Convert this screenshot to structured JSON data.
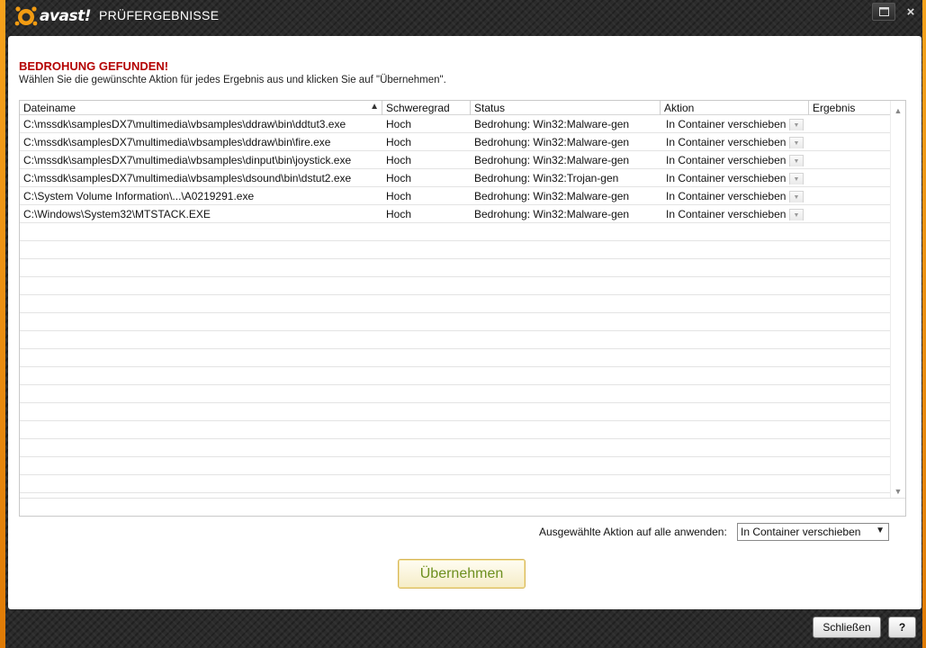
{
  "window": {
    "brand": "avast!",
    "title": "PRÜFERGEBNISSE",
    "close_glyph": "×"
  },
  "message": {
    "heading": "BEDROHUNG GEFUNDEN!",
    "instruction": "Wählen Sie die gewünschte Aktion für jedes Ergebnis aus und klicken Sie auf \"Übernehmen\"."
  },
  "grid": {
    "columns": [
      "Dateiname",
      "Schweregrad",
      "Status",
      "Aktion",
      "Ergebnis"
    ],
    "sort_column": "Dateiname",
    "sort_direction": "ascending",
    "rows": [
      {
        "file": "C:\\mssdk\\samplesDX7\\multimedia\\vbsamples\\ddraw\\bin\\ddtut3.exe",
        "severity": "Hoch",
        "status": "Bedrohung: Win32:Malware-gen",
        "action": "In Container verschieben",
        "result": ""
      },
      {
        "file": "C:\\mssdk\\samplesDX7\\multimedia\\vbsamples\\ddraw\\bin\\fire.exe",
        "severity": "Hoch",
        "status": "Bedrohung: Win32:Malware-gen",
        "action": "In Container verschieben",
        "result": ""
      },
      {
        "file": "C:\\mssdk\\samplesDX7\\multimedia\\vbsamples\\dinput\\bin\\joystick.exe",
        "severity": "Hoch",
        "status": "Bedrohung: Win32:Malware-gen",
        "action": "In Container verschieben",
        "result": ""
      },
      {
        "file": "C:\\mssdk\\samplesDX7\\multimedia\\vbsamples\\dsound\\bin\\dstut2.exe",
        "severity": "Hoch",
        "status": "Bedrohung: Win32:Trojan-gen",
        "action": "In Container verschieben",
        "result": ""
      },
      {
        "file": "C:\\System Volume Information\\...\\A0219291.exe",
        "severity": "Hoch",
        "status": "Bedrohung: Win32:Malware-gen",
        "action": "In Container verschieben",
        "result": ""
      },
      {
        "file": "C:\\Windows\\System32\\MTSTACK.EXE",
        "severity": "Hoch",
        "status": "Bedrohung: Win32:Malware-gen",
        "action": "In Container verschieben",
        "result": ""
      }
    ],
    "empty_rows": 16
  },
  "apply_all": {
    "label": "Ausgewählte Aktion auf alle anwenden:",
    "selected": "In Container verschieben"
  },
  "buttons": {
    "apply": "Übernehmen",
    "close": "Schließen",
    "help": "?"
  },
  "colors": {
    "accent_orange": "#f39c12",
    "alert_red": "#b40000",
    "apply_text_green": "#6d8f1e"
  }
}
